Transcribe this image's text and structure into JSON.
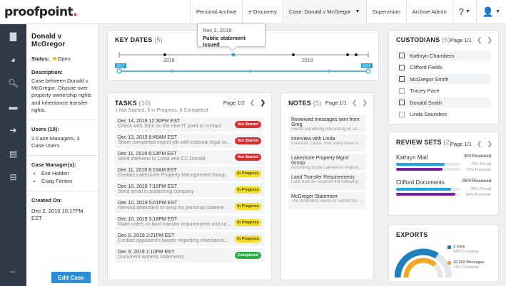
{
  "brand": {
    "logo_text": "proofpoint",
    "logo_dot": "."
  },
  "nav": {
    "tabs": [
      "Personal Archive",
      "e-Discovery",
      "Case: Donald v McGregor",
      "Supervision",
      "Archive Admin"
    ],
    "help_icon": "?",
    "user_icon": "user-icon"
  },
  "case": {
    "name": "Donald v McGregor",
    "status_label": "Status:",
    "status_value": "Open",
    "description_label": "Description:",
    "description": "Case between Donald v McGregor. Dispute over property ownership rights and inheritance transfer rights.",
    "users_label": "Users (10):",
    "users_text": "2 Case Managers, 3 Case Users",
    "managers_label": "Case Manager(s):",
    "managers": [
      "Eve Holden",
      "Craig Fenton"
    ],
    "created_label": "Created On:",
    "created_value": "Dec 2, 2019 10:17PM EST",
    "edit_button": "Edit Case"
  },
  "key_dates": {
    "title": "KEY DATES",
    "count": "(5)",
    "year_a": "2018",
    "year_b": "2019",
    "range_start": "2017",
    "range_end": "2019",
    "tooltip_date": "Nov 3, 2018",
    "tooltip_text": "Public statement issued"
  },
  "tasks": {
    "title": "TASKS",
    "count": "(10)",
    "summary": "1 Not Started, 3 In Progress, 6 Completed",
    "pager": "Page 1/2",
    "items": [
      {
        "date": "Dec 14, 2019 12:30PM EST",
        "desc": "Check with John on the new IT point of contact",
        "status": "Not Started",
        "cls": "b-ns"
      },
      {
        "date": "Dec 13, 2019 8:45AM EST",
        "desc": "Share completed export job with external legal co...",
        "status": "Not Started",
        "cls": "b-ns"
      },
      {
        "date": "Dec 11, 2019 6:12PM EST",
        "desc": "Send interview to Linda and CC Donald",
        "status": "Not Started",
        "cls": "b-ns"
      },
      {
        "date": "Dec 11, 2019 8:10AM EST",
        "desc": "Contact Lakeshore Property Management Group",
        "status": "In Progress",
        "cls": "b-ip"
      },
      {
        "date": "Dec 10, 2019 7:10PM EST",
        "desc": "Send email to publishing company",
        "status": "In Progress",
        "cls": "b-ip"
      },
      {
        "date": "Dec 10, 2019 5:01PM EST",
        "desc": "Remind defendent to send his personal stateme...",
        "status": "In Progress",
        "cls": "b-ip"
      },
      {
        "date": "Dec 10, 2019 3:16PM EST",
        "desc": "Make notes on land transfer requirements and se...",
        "status": "In Progress",
        "cls": "b-ip"
      },
      {
        "date": "Dec 9, 2019 2:21PM EST",
        "desc": "Contact opponent's lawyer regarding inheritance...",
        "status": "In Progress",
        "cls": "b-ip"
      },
      {
        "date": "Dec 9, 2019 1:10PM EST",
        "desc": "Document witness statements",
        "status": "Completed",
        "cls": "b-c"
      }
    ]
  },
  "notes": {
    "title": "NOTES",
    "count": "(5)",
    "pager": "Page 1/1",
    "items": [
      {
        "title": "Reviewed messages sent from Greg",
        "preview": "Found something interesting on June 2"
      },
      {
        "title": "Interview with Linda",
        "preview": "Question. Linda, how many times did th..."
      },
      {
        "title": "Lakeshore Property Mgmt Group",
        "preview": "According to the Lakeshore Property Gro..."
      },
      {
        "title": "Land Transfer Requirements",
        "preview": "Land transfer requires the following thin..."
      },
      {
        "title": "McGregor Statement",
        "preview": "The defendent needs to submit his pape..."
      }
    ]
  },
  "custodians": {
    "title": "CUSTODIANS",
    "count": "(6)",
    "pager": "Page 1/1",
    "items": [
      "Kathryn Chambers",
      "Clifford Fields",
      "McGregor Smith",
      "Tracey Pace",
      "Donald Smith",
      "Linda Saunders"
    ]
  },
  "review_sets": {
    "title": "REVIEW SETS",
    "count": "(2)",
    "pager": "Page 1/1",
    "items": [
      {
        "name": "Kathryn Mail",
        "reviewed": "300 Reviewed",
        "recall": "75% Recall",
        "precision": "72% Precision",
        "recall_frac": 0.75,
        "precision_frac": 0.72
      },
      {
        "name": "Clifford Documents",
        "reviewed": "2500 Reviewed",
        "recall": "85% Recall",
        "precision": "92% Precision",
        "recall_frac": 0.85,
        "precision_frac": 0.92
      }
    ],
    "colors": {
      "recall": "#1ea7d8",
      "precision": "#7b1fa2"
    }
  },
  "exports": {
    "title": "EXPORTS",
    "items": [
      {
        "main": "3 Jobs",
        "sub": "68% Complete",
        "frac": 0.68,
        "color": "#1e7fbf"
      },
      {
        "main": "42,203 Messages",
        "sub": "74% Complete",
        "frac": 0.74,
        "color": "#f5a623"
      }
    ]
  }
}
